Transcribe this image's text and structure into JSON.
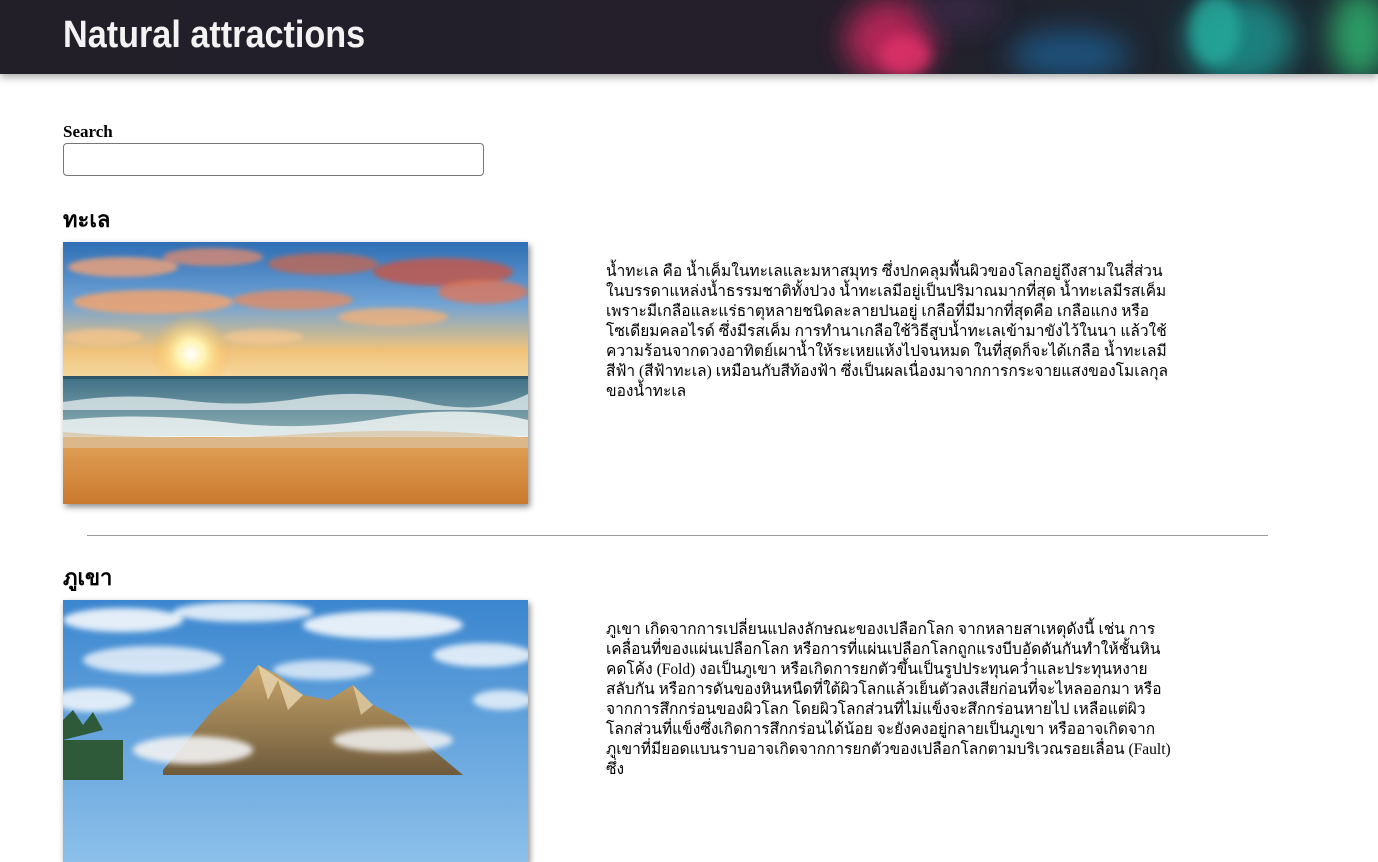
{
  "header": {
    "title": "Natural attractions"
  },
  "search": {
    "label": "Search",
    "value": "",
    "placeholder": ""
  },
  "attractions": [
    {
      "title": "ทะเล",
      "image": "sea-sunset-beach-photo",
      "description": "น้ำทะเล คือ น้ำเค็มในทะเลและมหาสมุทร ซึ่งปกคลุมพื้นผิวของโลกอยู่ถึงสามในสี่ส่วน ในบรรดาแหล่งน้ำธรรมชาติทั้งปวง น้ำทะเลมีอยู่เป็นปริมาณมากที่สุด น้ำทะเลมีรสเค็ม เพราะมีเกลือและแร่ธาตุหลายชนิดละลายปนอยู่ เกลือที่มีมากที่สุดคือ เกลือแกง หรือ โซเดียมคลอไรด์ ซึ่งมีรสเค็ม การทำนาเกลือใช้วิธีสูบน้ำทะเลเข้ามาขังไว้ในนา แล้วใช้ความร้อนจากดวงอาทิตย์เผาน้ำให้ระเหยแห้งไปจนหมด ในที่สุดก็จะได้เกลือ น้ำทะเลมีสีฟ้า (สีฟ้าทะเล) เหมือนกับสีท้องฟ้า ซึ่งเป็นผลเนื่องมาจากการกระจายแสงของโมเลกุลของน้ำทะเล"
    },
    {
      "title": "ภูเขา",
      "image": "mountain-peak-photo",
      "description": "ภูเขา เกิดจากการเปลี่ยนแปลงลักษณะของเปลือกโลก จากหลายสาเหตุดังนี้ เช่น การเคลื่อนที่ของแผ่นเปลือกโลก หรือการที่แผ่นเปลือกโลกถูกแรงบีบอัดดันกันทำให้ชั้นหินคดโค้ง (Fold) งอเป็นภูเขา หรือเกิดการยกตัวขึ้นเป็นรูปประทุนคว่ำและประทุนหงายสลับกัน หรือการดันของหินหนืดที่ใต้ผิวโลกแล้วเย็นตัวลงเสียก่อนที่จะไหลออกมา หรือจากการสึกกร่อนของผิวโลก โดยผิวโลกส่วนที่ไม่แข็งจะสึกกร่อนหายไป เหลือแต่ผิวโลกส่วนที่แข็งซึ่งเกิดการสึกกร่อนได้น้อย จะยังคงอยู่กลายเป็นภูเขา หรืออาจเกิดจากภูเขาที่มียอดแบนราบอาจเกิดจากการยกตัวของเปลือกโลกตามบริเวณรอยเลื่อน (Fault) ซึ่ง"
    }
  ]
}
